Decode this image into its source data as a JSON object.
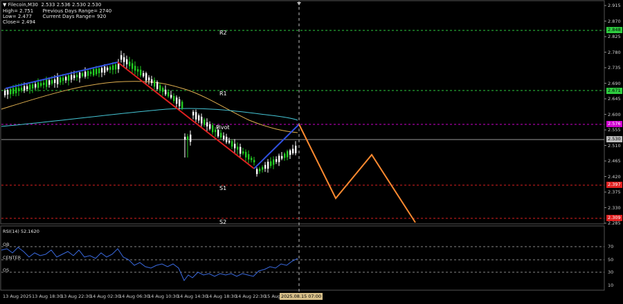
{
  "header": {
    "line1": "▼ Filecoin,M30  2.533 2.536 2.530 2.530",
    "line2": "High= 2.751      Previous Days Range= 2740",
    "line3": "Low= 2.477       Current Days Range= 920",
    "line4": "Close= 2.494"
  },
  "levels": {
    "r2": "R2",
    "r1": "R1",
    "pivot": "Pivot",
    "s1": "S1",
    "s2": "S2"
  },
  "price_tags": {
    "r2": "2.848",
    "r1": "2.671",
    "pivot": "2.576",
    "current": "2.530",
    "s1": "2.397",
    "s2": "2.309"
  },
  "price_axis": [
    "2.915",
    "2.870",
    "2.825",
    "2.780",
    "2.735",
    "2.690",
    "2.645",
    "2.600",
    "2.555",
    "2.510",
    "2.465",
    "2.420",
    "2.375",
    "2.330",
    "2.285"
  ],
  "time_axis": [
    "13 Aug 2025",
    "13 Aug 18:30",
    "13 Aug 22:30",
    "14 Aug 02:30",
    "14 Aug 06:30",
    "14 Aug 10:30",
    "14 Aug 14:30",
    "14 Aug 18:30",
    "14 Aug 22:30",
    "15 Aug"
  ],
  "time_cursor": "2025.08.15 07:00",
  "rsi": {
    "title": "RSI(14) 52.1620",
    "ob": "OB",
    "center": "CENTER",
    "os": "OS",
    "axis": [
      "70",
      "50",
      "30",
      "10"
    ]
  },
  "colors": {
    "r2": "#2ecc40",
    "r1": "#2ecc40",
    "pivot": "#d000d0",
    "s1": "#e02020",
    "s2": "#e02020",
    "bull": "#ffffff",
    "bear": "#22cc22",
    "ma_fast": "#e0b050",
    "ma_slow": "#46c8d8",
    "trend_up": "#3050e0",
    "trend_down": "#e02020",
    "forecast": "#ff8a30"
  }
}
